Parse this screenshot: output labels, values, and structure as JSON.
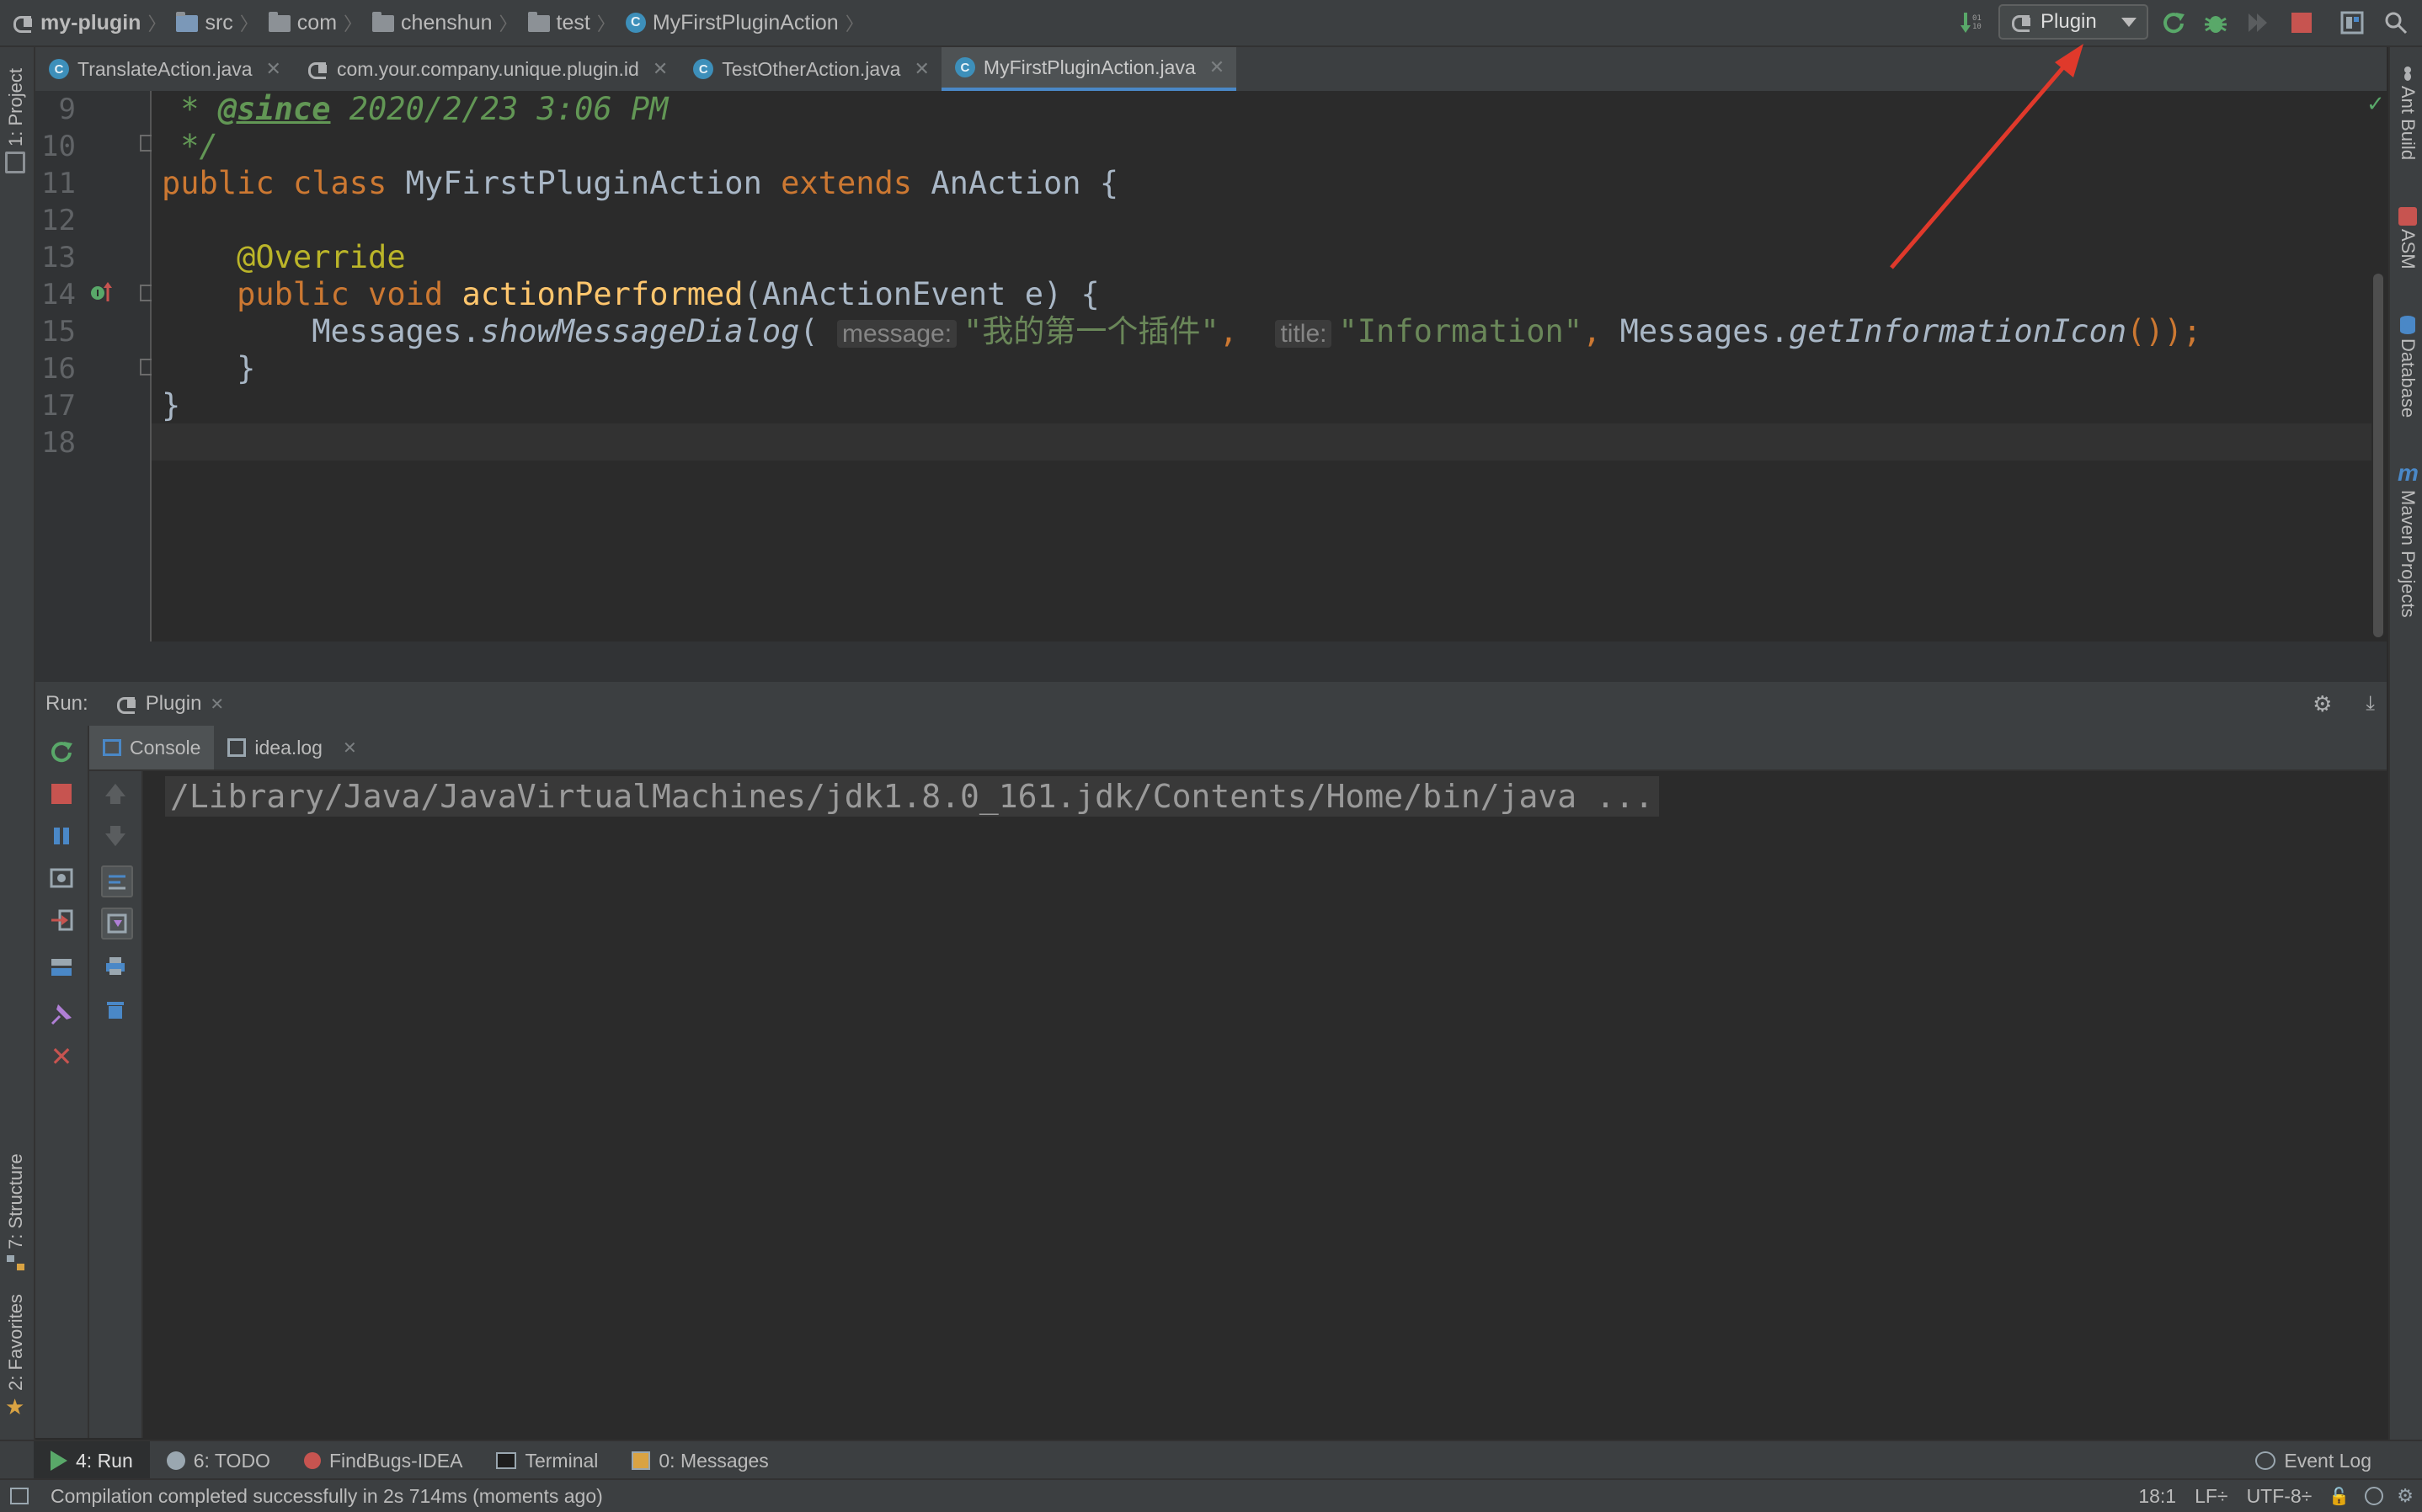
{
  "breadcrumbs": [
    "my-plugin",
    "src",
    "com",
    "chenshun",
    "test",
    "MyFirstPluginAction"
  ],
  "run_config": {
    "selected": "Plugin"
  },
  "tabs": [
    {
      "label": "TranslateAction.java",
      "icon": "class-icon"
    },
    {
      "label": "com.your.company.unique.plugin.id",
      "icon": "plugin-icon"
    },
    {
      "label": "TestOtherAction.java",
      "icon": "class-icon"
    },
    {
      "label": "MyFirstPluginAction.java",
      "icon": "class-icon",
      "active": true
    }
  ],
  "left_strip": {
    "project": "1: Project",
    "structure": "7: Structure",
    "favorites": "2: Favorites"
  },
  "right_strip": {
    "ant": "Ant Build",
    "asm": "ASM",
    "database": "Database",
    "maven": "Maven Projects"
  },
  "editor": {
    "line_numbers": [
      "9",
      "10",
      "11",
      "12",
      "13",
      "14",
      "15",
      "16",
      "17",
      "18"
    ],
    "code": {
      "l9_prefix": " * ",
      "l9_tag": "@since",
      "l9_rest": " 2020/2/23 3:06 PM",
      "l10": " */",
      "l11_kw1": "public",
      "l11_kw2": "class",
      "l11_name": "MyFirstPluginAction",
      "l11_kw3": "extends",
      "l11_base": "AnAction {",
      "l13_annotation": "@Override",
      "l14_kw1": "public",
      "l14_kw2": "void",
      "l14_method": "actionPerformed",
      "l14_params": "(AnActionEvent e) {",
      "l15_obj": "Messages.",
      "l15_call": "showMessageDialog",
      "l15_paren": "(",
      "l15_hint1": "message:",
      "l15_str1": "\"我的第一个插件\"",
      "l15_comma1": ",",
      "l15_hint2": "title:",
      "l15_str2": "\"Information\"",
      "l15_comma2": ",",
      "l15_obj2": " Messages.",
      "l15_call2": "getInformationIcon",
      "l15_end": "());",
      "l16": "    }",
      "l17": "}"
    }
  },
  "run_panel": {
    "label": "Run:",
    "config_tab": "Plugin",
    "subtabs": [
      "Console",
      "idea.log"
    ],
    "console_line": "/Library/Java/JavaVirtualMachines/jdk1.8.0_161.jdk/Contents/Home/bin/java ..."
  },
  "tool_windows": [
    {
      "label": "4: Run",
      "icon": "run-icon",
      "active": true
    },
    {
      "label": "6: TODO",
      "icon": "todo-icon"
    },
    {
      "label": "FindBugs-IDEA",
      "icon": "bug-icon"
    },
    {
      "label": "Terminal",
      "icon": "terminal-icon"
    },
    {
      "label": "0: Messages",
      "icon": "messages-icon"
    }
  ],
  "event_log": "Event Log",
  "status": {
    "message": "Compilation completed successfully in 2s 714ms (moments ago)",
    "position": "18:1",
    "line_sep": "LF÷",
    "encoding": "UTF-8÷"
  },
  "colors": {
    "accent": "#4a88c7",
    "annotation_arrow": "#e0392b",
    "run_green": "#59a869",
    "stop_red": "#c75450"
  }
}
